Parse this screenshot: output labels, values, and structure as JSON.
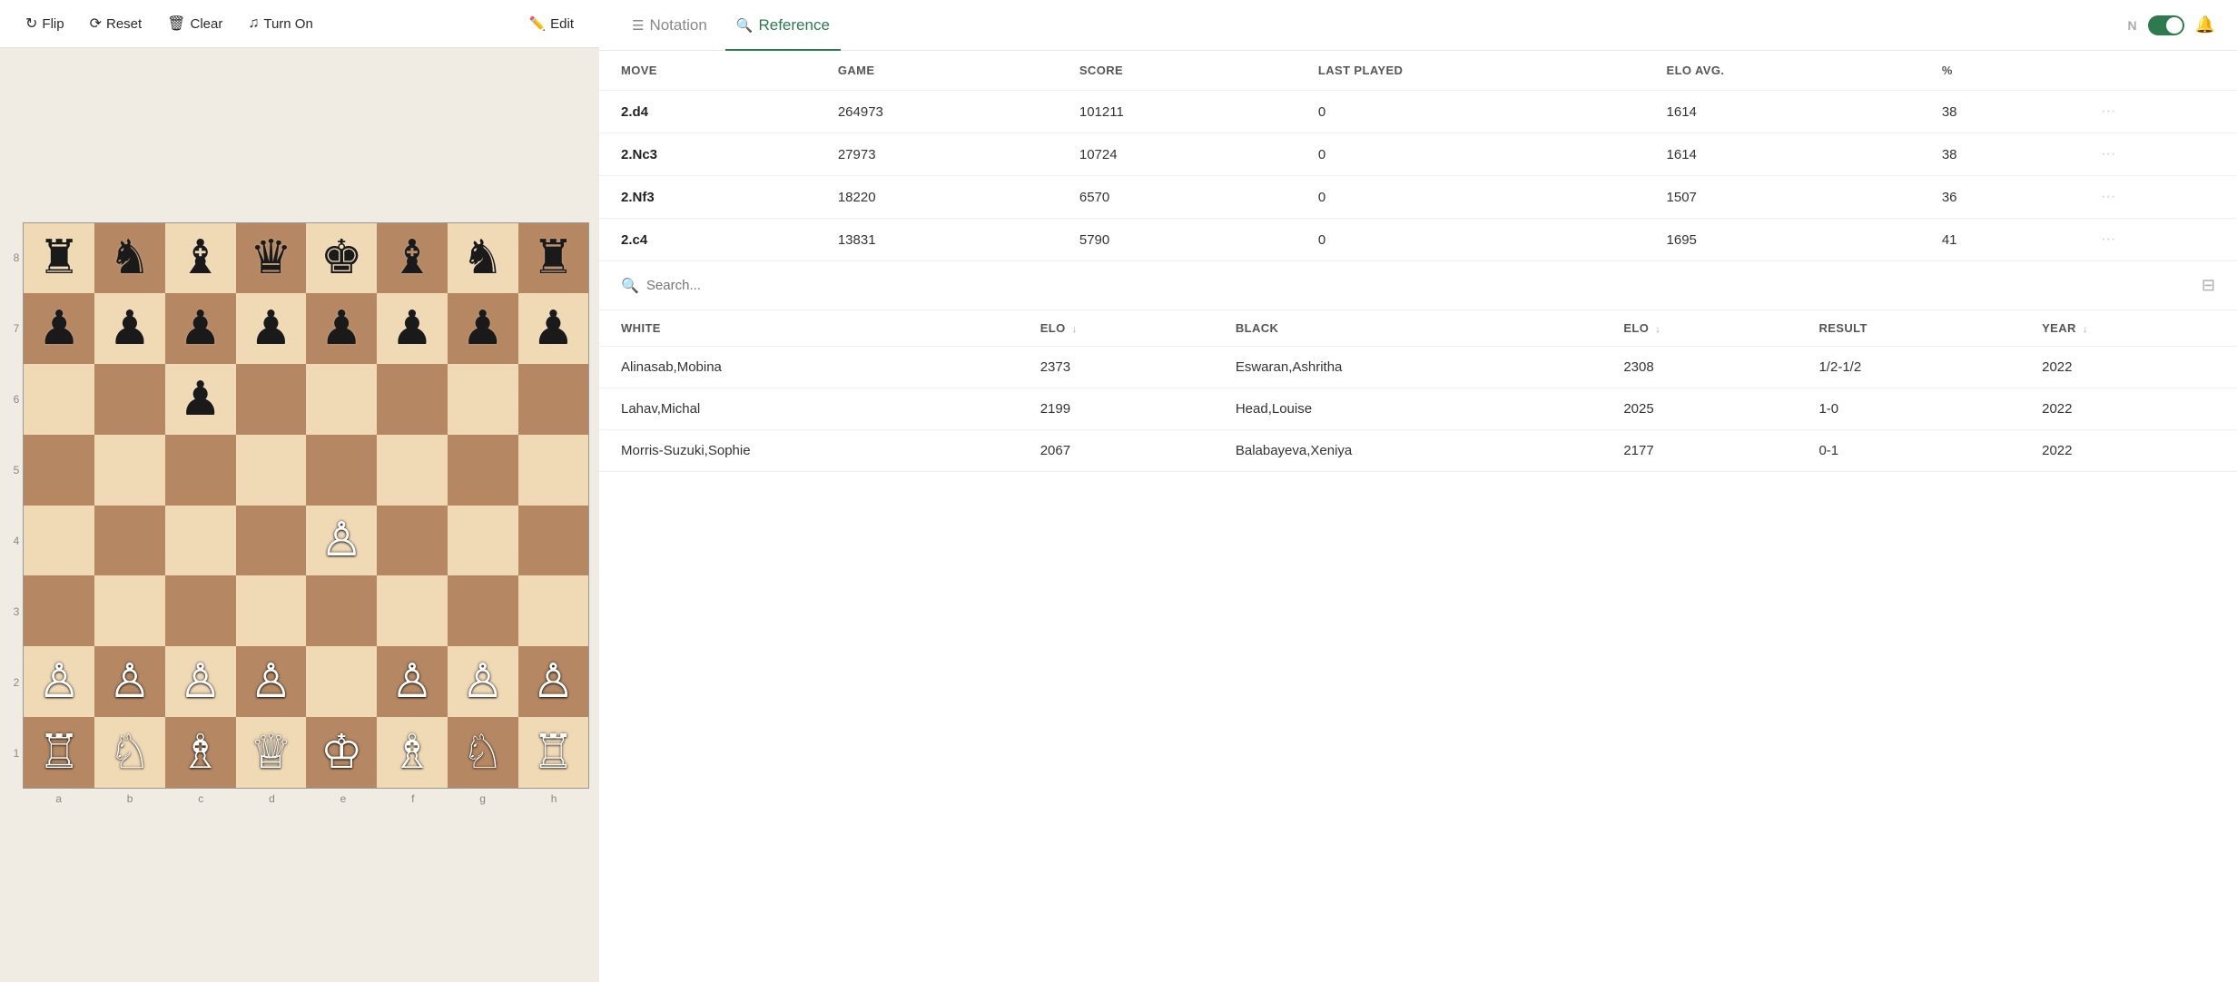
{
  "toolbar": {
    "flip_label": "Flip",
    "reset_label": "Reset",
    "clear_label": "Clear",
    "turnon_label": "Turn On",
    "edit_label": "Edit"
  },
  "tabs": {
    "notation_label": "Notation",
    "reference_label": "Reference"
  },
  "header_actions": {
    "n_label": "N",
    "bell_label": "🔔"
  },
  "moves_table": {
    "columns": [
      "MOVE",
      "GAME",
      "SCORE",
      "LAST PLAYED",
      "ELO AVG.",
      "%"
    ],
    "rows": [
      {
        "move": "2.d4",
        "game": "264973",
        "score": "101211",
        "last_played": "0",
        "elo_avg": "1614",
        "pct": "38"
      },
      {
        "move": "2.Nc3",
        "game": "27973",
        "score": "10724",
        "last_played": "0",
        "elo_avg": "1614",
        "pct": "38"
      },
      {
        "move": "2.Nf3",
        "game": "18220",
        "score": "6570",
        "last_played": "0",
        "elo_avg": "1507",
        "pct": "36"
      },
      {
        "move": "2.c4",
        "game": "13831",
        "score": "5790",
        "last_played": "0",
        "elo_avg": "1695",
        "pct": "41"
      }
    ]
  },
  "search": {
    "placeholder": "Search..."
  },
  "games_table": {
    "columns": [
      {
        "label": "WHITE",
        "sort": false
      },
      {
        "label": "ELO",
        "sort": true
      },
      {
        "label": "BLACK",
        "sort": false
      },
      {
        "label": "ELO",
        "sort": true
      },
      {
        "label": "RESULT",
        "sort": false
      },
      {
        "label": "YEAR",
        "sort": true
      }
    ],
    "rows": [
      {
        "white": "Alinasab,Mobina",
        "white_elo": "2373",
        "black": "Eswaran,Ashritha",
        "black_elo": "2308",
        "result": "1/2-1/2",
        "year": "2022"
      },
      {
        "white": "Lahav,Michal",
        "white_elo": "2199",
        "black": "Head,Louise",
        "black_elo": "2025",
        "result": "1-0",
        "year": "2022"
      },
      {
        "white": "Morris-Suzuki,Sophie",
        "white_elo": "2067",
        "black": "Balabayeva,Xeniya",
        "black_elo": "2177",
        "result": "0-1",
        "year": "2022"
      }
    ]
  },
  "board": {
    "ranks": [
      "8",
      "7",
      "6",
      "5",
      "4",
      "3",
      "2",
      "1"
    ],
    "files": [
      "a",
      "b",
      "c",
      "d",
      "e",
      "f",
      "g",
      "h"
    ],
    "squares": [
      "♜",
      "♞",
      "♝",
      "♛",
      "♚",
      "♝",
      "♞",
      "♜",
      "♟",
      "♟",
      "♟",
      "♟",
      "♟",
      "♟",
      "♟",
      "♟",
      "",
      "",
      "♟",
      "",
      "",
      "",
      "",
      "",
      "",
      "",
      "",
      "",
      "",
      "",
      "",
      "",
      "",
      "",
      "",
      "",
      "♙",
      "",
      "",
      "",
      "",
      "",
      "",
      "",
      "",
      "",
      "",
      "",
      "♙",
      "♙",
      "♙",
      "♙",
      "",
      "♙",
      "♙",
      "♙",
      "♖",
      "♘",
      "♗",
      "♕",
      "♔",
      "♗",
      "♘",
      "♖"
    ]
  }
}
